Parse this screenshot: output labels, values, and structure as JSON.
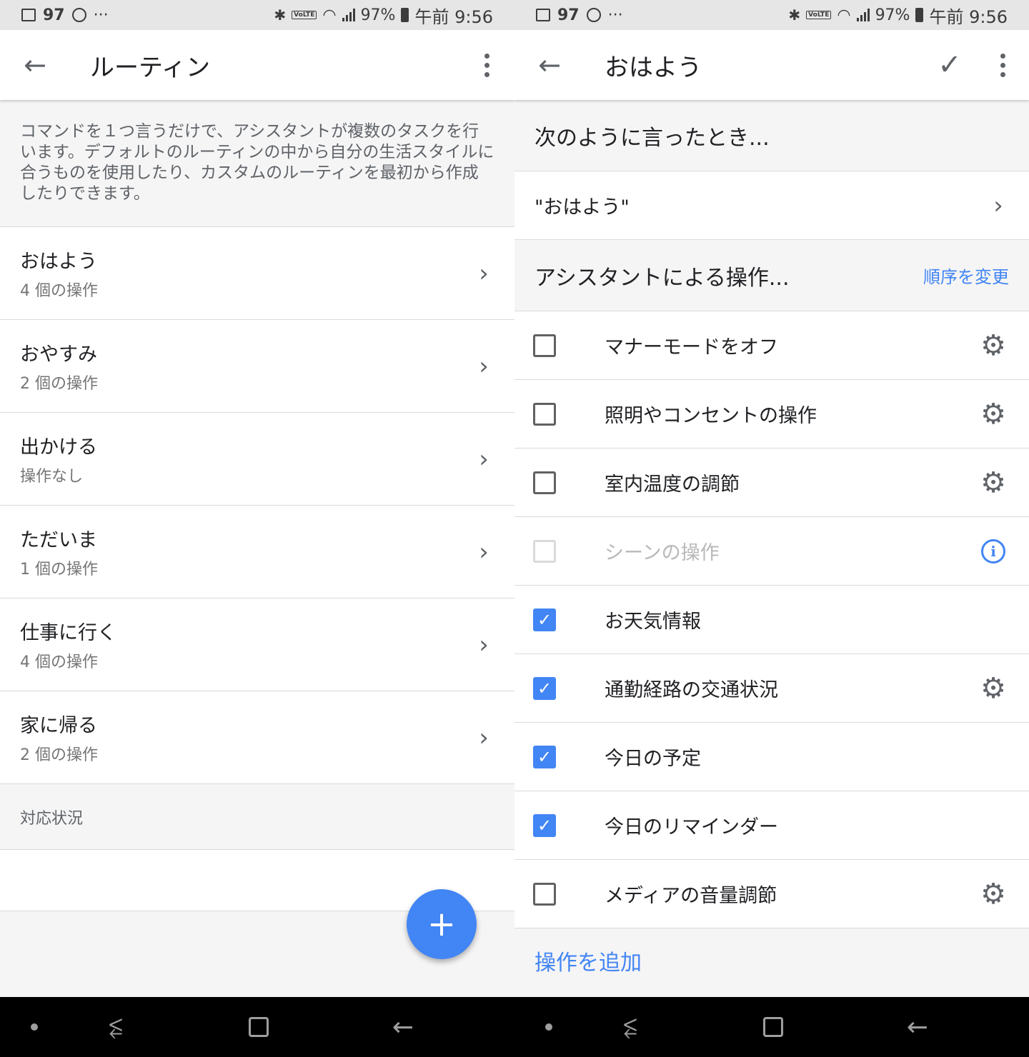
{
  "status_bar": {
    "left_number": "97",
    "more": "···",
    "battery_text": "97%",
    "time": "午前 9:56",
    "volte": "VoLTE"
  },
  "left": {
    "title": "ルーティン",
    "description": "コマンドを１つ言うだけで、アシスタントが複数のタスクを行います。デフォルトのルーティンの中から自分の生活スタイルに合うものを使用したり、カスタムのルーティンを最初から作成したりできます。",
    "routines": [
      {
        "name": "おはよう",
        "sub": "4 個の操作"
      },
      {
        "name": "おやすみ",
        "sub": "2 個の操作"
      },
      {
        "name": "出かける",
        "sub": "操作なし"
      },
      {
        "name": "ただいま",
        "sub": "1 個の操作"
      },
      {
        "name": "仕事に行く",
        "sub": "4 個の操作"
      },
      {
        "name": "家に帰る",
        "sub": "2 個の操作"
      }
    ],
    "section": "対応状況",
    "fab_label": "+"
  },
  "right": {
    "title": "おはよう",
    "when_heading": "次のように言ったとき...",
    "phrase": "\"おはよう\"",
    "actions_heading": "アシスタントによる操作...",
    "reorder": "順序を変更",
    "actions": [
      {
        "label": "マナーモードをオフ",
        "checked": false,
        "disabled": false,
        "icon": "gear-icon"
      },
      {
        "label": "照明やコンセントの操作",
        "checked": false,
        "disabled": false,
        "icon": "gear-icon"
      },
      {
        "label": "室内温度の調節",
        "checked": false,
        "disabled": false,
        "icon": "gear-icon"
      },
      {
        "label": "シーンの操作",
        "checked": false,
        "disabled": true,
        "icon": "info-icon"
      },
      {
        "label": "お天気情報",
        "checked": true,
        "disabled": false,
        "icon": ""
      },
      {
        "label": "通勤経路の交通状況",
        "checked": true,
        "disabled": false,
        "icon": "gear-icon"
      },
      {
        "label": "今日の予定",
        "checked": true,
        "disabled": false,
        "icon": ""
      },
      {
        "label": "今日のリマインダー",
        "checked": true,
        "disabled": false,
        "icon": ""
      },
      {
        "label": "メディアの音量調節",
        "checked": false,
        "disabled": false,
        "icon": "gear-icon"
      }
    ],
    "add_action": "操作を追加"
  },
  "colors": {
    "accent": "#4285f4",
    "text_primary": "#202124",
    "text_secondary": "#757575",
    "divider": "#dadada",
    "background": "#f5f5f5"
  }
}
